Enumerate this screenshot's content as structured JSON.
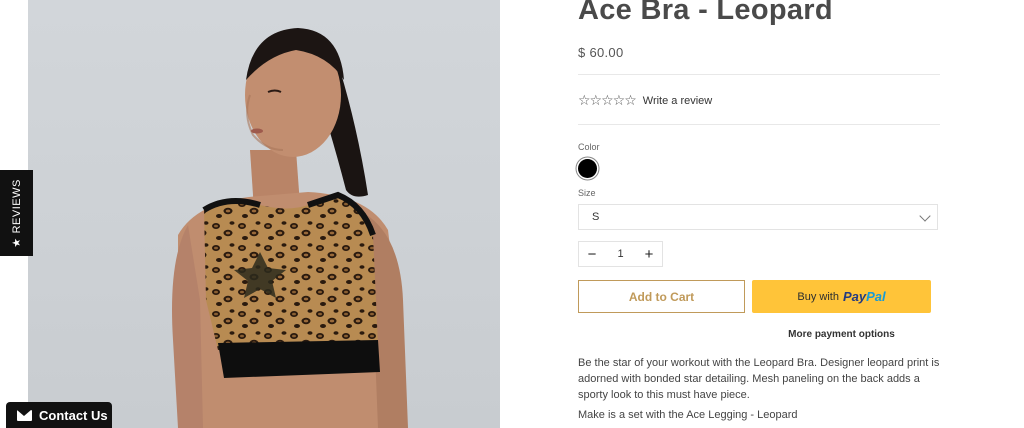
{
  "product": {
    "title": "Ace Bra - Leopard",
    "price": "$ 60.00",
    "rating": {
      "stars": "☆☆☆☆☆",
      "write_review": "Write a review"
    },
    "color": {
      "label": "Color",
      "selected": "#000000"
    },
    "size": {
      "label": "Size",
      "selected": "S"
    },
    "quantity": {
      "decrement": "−",
      "value": "1",
      "increment": "+"
    },
    "add_to_cart": "Add to Cart",
    "paypal": {
      "prefix": "Buy with",
      "brand_pay": "Pay",
      "brand_pal": "Pal"
    },
    "more_payment": "More payment options",
    "description": [
      "Be the star of your workout with the Leopard Bra.   Designer leopard print is adorned with bonded star detailing.   Mesh paneling on the back adds a sporty look to this must have piece.",
      "Make is a set with the Ace Legging - Leopard"
    ]
  },
  "reviews_tab": {
    "icon": "★",
    "label": "REVIEWS"
  },
  "contact": {
    "label": "Contact Us",
    "icon": "envelope-icon"
  },
  "colors": {
    "accent_gold": "#c09a5a",
    "paypal_yellow": "#ffc439",
    "tab_black": "#111111"
  }
}
